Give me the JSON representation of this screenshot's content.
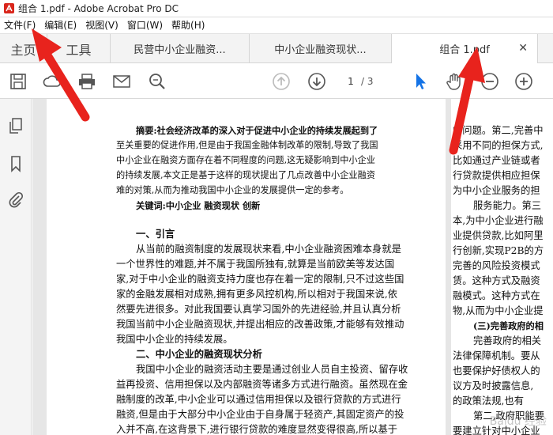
{
  "window": {
    "title": "组合 1.pdf - Adobe Acrobat Pro DC"
  },
  "menu": [
    "文件(F)",
    "编辑(E)",
    "视图(V)",
    "窗口(W)",
    "帮助(H)"
  ],
  "tabs": [
    {
      "label": "主页"
    },
    {
      "label": "工具"
    },
    {
      "label": "民营中小企业融资..."
    },
    {
      "label": "中小企业融资现状..."
    },
    {
      "label": "组合 1.pdf",
      "active": true
    }
  ],
  "toolbar": {
    "page_current": "1",
    "page_total": "/ 3"
  },
  "doc": {
    "left_lines": [
      "摘要:社会经济改革的深入对于促进中小企业的持续发展起到了",
      "至关重要的促进作用,但是由于我国金融体制改革的限制,导致了我国",
      "中小企业在融资方面存在着不同程度的问题,这无疑影响到中小企业",
      "的持续发展,本文正是基于这样的现状提出了几点改善中小企业融资",
      "难的对策,从而为推动我国中小企业的发展提供一定的参考。",
      "关键词:中小企业  融资现状  创新",
      "一、引言",
      "从当前的融资制度的发展现状来看,中小企业融资困难本身就是",
      "一个世界性的难题,并不属于我国所独有,就算是当前欧美等发达国",
      "家,对于中小企业的融资支持力度也存在着一定的限制,只不过这些国",
      "家的金融发展相对成熟,拥有更多风控机构,所以相对于我国来说,依",
      "然要先进很多。对此我国要认真学习国外的先进经验,并且认真分析",
      "我国当前中小企业融资现状,并提出相应的改善政策,才能够有效推动",
      "我国中小企业的持续发展。",
      "二、中小企业的融资现状分析",
      "我国中小企业的融资活动主要是通过创业人员自主投资、留存收",
      "益再投资、信用担保以及内部融资等诸多方式进行融资。虽然现在金",
      "融制度的改革,中小企业可以通过信用担保以及银行贷款的方式进行",
      "融资,但是由于大部分中小企业由于自身属于轻资产,其固定资产的投",
      "入并不高,在这背景下,进行银行贷款的难度显然变得很高,所以基于"
    ],
    "right_lines": [
      "的问题。第二,完善中",
      "采用不同的担保方式,",
      "比如通过产业链或者",
      "行贷款提供相应担保",
      "为中小企业服务的担",
      "服务能力。第三",
      "本,为中小企业进行融",
      "业提供贷款,比如阿里",
      "行创新,实现P2B的方",
      "完善的风险投资模式",
      "赁。这种方式及融资",
      "融模式。这种方式在",
      "物,从而为中小企业提",
      "(三)完善政府的相",
      "完善政府的相关",
      "法律保障机制。要从",
      "也要保护好债权人的",
      "议方及时披露信息,",
      "的政策法规,也有",
      "第二,政府职能要",
      "要建立针对中小企业"
    ],
    "watermark": "Baidu 经验"
  }
}
